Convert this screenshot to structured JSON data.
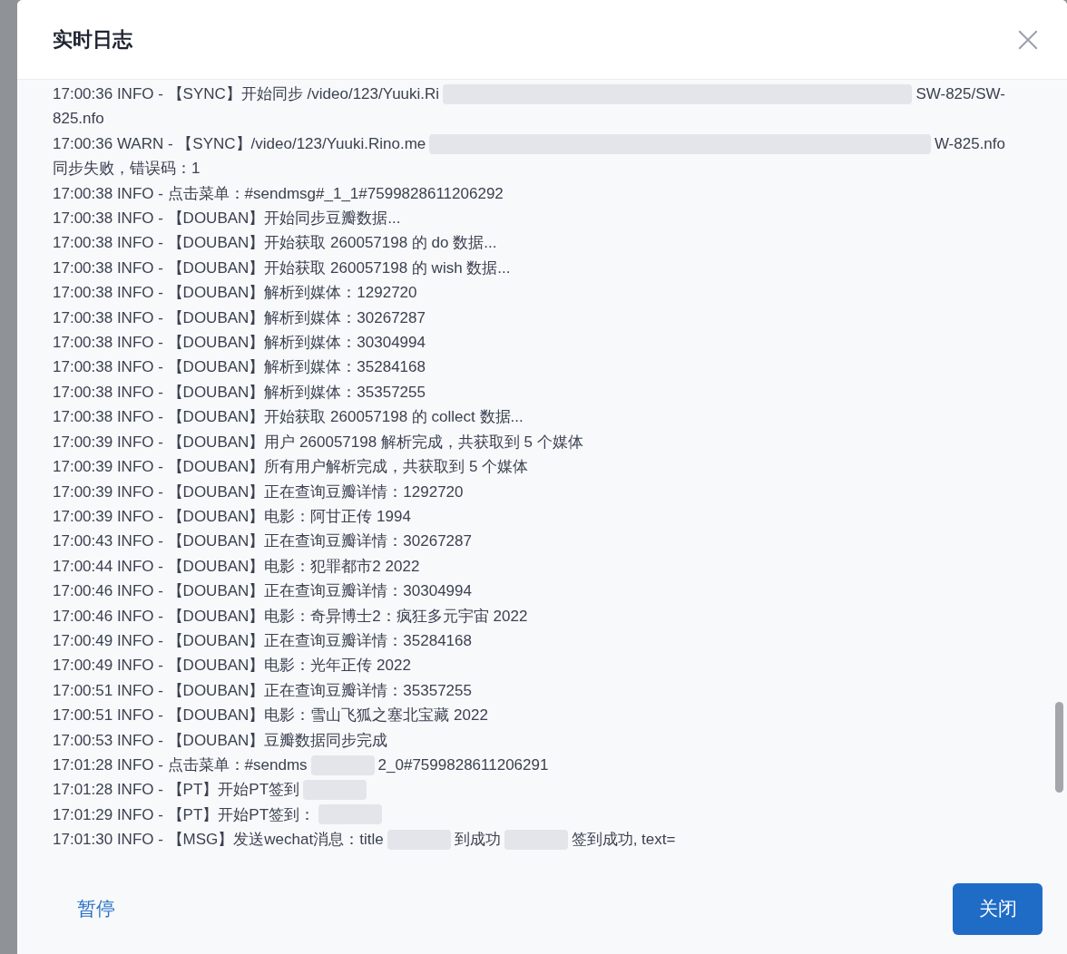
{
  "dialog": {
    "title": "实时日志"
  },
  "log_lines": [
    {
      "segments": [
        {
          "kind": "text",
          "text": "17:00:36 INFO - 【SYNC】开始同步 /video/123/Yuuki.Ri"
        },
        {
          "kind": "band"
        },
        {
          "kind": "text",
          "text": "SW-825/SW-"
        }
      ],
      "wrap": "825.nfo"
    },
    {
      "segments": [
        {
          "kind": "text",
          "text": "17:00:36 WARN - 【SYNC】/video/123/Yuuki.Rino.me"
        },
        {
          "kind": "band"
        },
        {
          "kind": "text",
          "text": "W-825.nfo"
        }
      ],
      "wrap": "同步失败，错误码：1"
    },
    {
      "segments": [
        {
          "kind": "text",
          "text": "17:00:38 INFO - 点击菜单：#sendmsg#_1_1#7599828611206292"
        }
      ]
    },
    {
      "segments": [
        {
          "kind": "text",
          "text": "17:00:38 INFO - 【DOUBAN】开始同步豆瓣数据..."
        }
      ]
    },
    {
      "segments": [
        {
          "kind": "text",
          "text": "17:00:38 INFO - 【DOUBAN】开始获取 260057198 的 do 数据..."
        }
      ]
    },
    {
      "segments": [
        {
          "kind": "text",
          "text": "17:00:38 INFO - 【DOUBAN】开始获取 260057198 的 wish 数据..."
        }
      ]
    },
    {
      "segments": [
        {
          "kind": "text",
          "text": "17:00:38 INFO - 【DOUBAN】解析到媒体：1292720"
        }
      ]
    },
    {
      "segments": [
        {
          "kind": "text",
          "text": "17:00:38 INFO - 【DOUBAN】解析到媒体：30267287"
        }
      ]
    },
    {
      "segments": [
        {
          "kind": "text",
          "text": "17:00:38 INFO - 【DOUBAN】解析到媒体：30304994"
        }
      ]
    },
    {
      "segments": [
        {
          "kind": "text",
          "text": "17:00:38 INFO - 【DOUBAN】解析到媒体：35284168"
        }
      ]
    },
    {
      "segments": [
        {
          "kind": "text",
          "text": "17:00:38 INFO - 【DOUBAN】解析到媒体：35357255"
        }
      ]
    },
    {
      "segments": [
        {
          "kind": "text",
          "text": "17:00:38 INFO - 【DOUBAN】开始获取 260057198 的 collect 数据..."
        }
      ]
    },
    {
      "segments": [
        {
          "kind": "text",
          "text": "17:00:39 INFO - 【DOUBAN】用户 260057198 解析完成，共获取到 5 个媒体"
        }
      ]
    },
    {
      "segments": [
        {
          "kind": "text",
          "text": "17:00:39 INFO - 【DOUBAN】所有用户解析完成，共获取到 5 个媒体"
        }
      ]
    },
    {
      "segments": [
        {
          "kind": "text",
          "text": "17:00:39 INFO - 【DOUBAN】正在查询豆瓣详情：1292720"
        }
      ]
    },
    {
      "segments": [
        {
          "kind": "text",
          "text": "17:00:39 INFO - 【DOUBAN】电影：阿甘正传 1994"
        }
      ]
    },
    {
      "segments": [
        {
          "kind": "text",
          "text": "17:00:43 INFO - 【DOUBAN】正在查询豆瓣详情：30267287"
        }
      ]
    },
    {
      "segments": [
        {
          "kind": "text",
          "text": "17:00:44 INFO - 【DOUBAN】电影：犯罪都市2 2022"
        }
      ]
    },
    {
      "segments": [
        {
          "kind": "text",
          "text": "17:00:46 INFO - 【DOUBAN】正在查询豆瓣详情：30304994"
        }
      ]
    },
    {
      "segments": [
        {
          "kind": "text",
          "text": "17:00:46 INFO - 【DOUBAN】电影：奇异博士2：疯狂多元宇宙 2022"
        }
      ]
    },
    {
      "segments": [
        {
          "kind": "text",
          "text": "17:00:49 INFO - 【DOUBAN】正在查询豆瓣详情：35284168"
        }
      ]
    },
    {
      "segments": [
        {
          "kind": "text",
          "text": "17:00:49 INFO - 【DOUBAN】电影：光年正传 2022"
        }
      ]
    },
    {
      "segments": [
        {
          "kind": "text",
          "text": "17:00:51 INFO - 【DOUBAN】正在查询豆瓣详情：35357255"
        }
      ]
    },
    {
      "segments": [
        {
          "kind": "text",
          "text": "17:00:51 INFO - 【DOUBAN】电影：雪山飞狐之塞北宝藏 2022"
        }
      ]
    },
    {
      "segments": [
        {
          "kind": "text",
          "text": "17:00:53 INFO - 【DOUBAN】豆瓣数据同步完成"
        }
      ]
    },
    {
      "segments": [
        {
          "kind": "text",
          "text": "17:01:28 INFO - 点击菜单：#sendms"
        },
        {
          "kind": "blur"
        },
        {
          "kind": "text",
          "text": "2_0#7599828611206291"
        }
      ]
    },
    {
      "segments": [
        {
          "kind": "text",
          "text": "17:01:28 INFO - 【PT】开始PT签到"
        },
        {
          "kind": "blur"
        }
      ]
    },
    {
      "segments": [
        {
          "kind": "text",
          "text": "17:01:29 INFO - 【PT】开始PT签到："
        },
        {
          "kind": "blur"
        }
      ]
    },
    {
      "segments": [
        {
          "kind": "text",
          "text": "17:01:30 INFO - 【MSG】发送wechat消息：title"
        },
        {
          "kind": "blur"
        },
        {
          "kind": "text",
          "text": "到成功"
        },
        {
          "kind": "blur"
        },
        {
          "kind": "text",
          "text": "签到成功, text="
        }
      ]
    }
  ],
  "footer": {
    "pause_link": "暂停",
    "close_button": "关闭"
  }
}
